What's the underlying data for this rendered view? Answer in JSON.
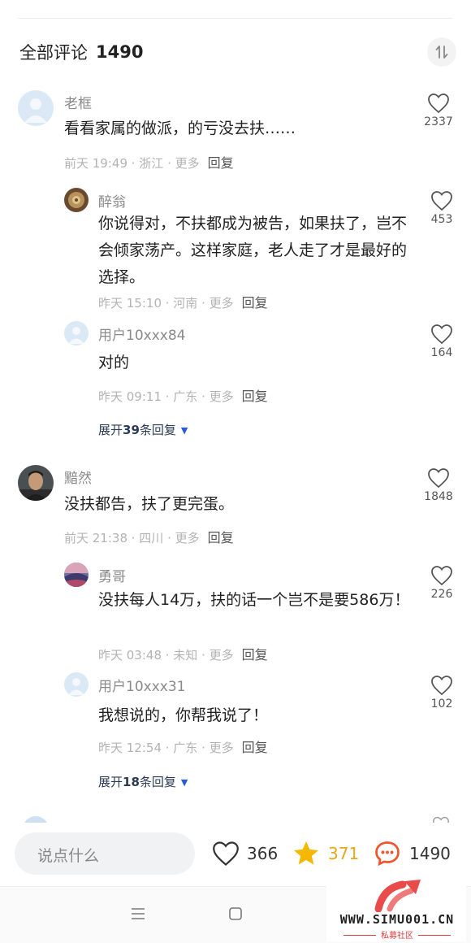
{
  "header": {
    "title": "全部评论",
    "count": "1490"
  },
  "comments": [
    {
      "name": "老框",
      "text": "看看家属的做派，的亏没去扶……",
      "time": "前天 19:49 · 浙江 · 更多",
      "reply": "回复",
      "likes": "2337",
      "replies": [
        {
          "name": "醉翁",
          "text": "你说得对，不扶都成为被告，如果扶了，岂不会倾家荡产。这样家庭，老人走了才是最好的选择。",
          "time": "昨天 15:10 · 河南 · 更多",
          "reply": "回复",
          "likes": "453"
        },
        {
          "name": "用户10xxx84",
          "text": "对的",
          "time": "昨天 09:11 · 广东 · 更多",
          "reply": "回复",
          "likes": "164"
        }
      ],
      "expand": {
        "prefix": "展开",
        "count": "39",
        "suffix": "条回复"
      }
    },
    {
      "name": "黯然",
      "text": "没扶都告，扶了更完蛋。",
      "time": "前天 21:38 · 四川 · 更多",
      "reply": "回复",
      "likes": "1848",
      "replies": [
        {
          "name": "勇哥",
          "text": "没扶每人14万，扶的话一个岂不是要586万！",
          "time": "昨天 03:48 · 未知 · 更多",
          "reply": "回复",
          "likes": "226"
        },
        {
          "name": "用户10xxx31",
          "text": "我想说的，你帮我说了！",
          "time": "昨天 12:54 · 广东 · 更多",
          "reply": "回复",
          "likes": "102"
        }
      ],
      "expand": {
        "prefix": "展开",
        "count": "18",
        "suffix": "条回复"
      }
    }
  ],
  "bottom_bar": {
    "input_placeholder": "说点什么",
    "likes": "366",
    "favorites": "371",
    "comments": "1490"
  },
  "watermark": {
    "site": "WWW.SIMU001.CN",
    "sub": "私募社区"
  },
  "icons": {
    "like": "heart-icon",
    "favorite": "star-icon",
    "comment": "chat-bubble-icon",
    "sort": "sort-icon"
  },
  "colors": {
    "star": "#f5b800",
    "comment_icon": "#f0562e",
    "expand_triangle": "#2b5bd0"
  }
}
